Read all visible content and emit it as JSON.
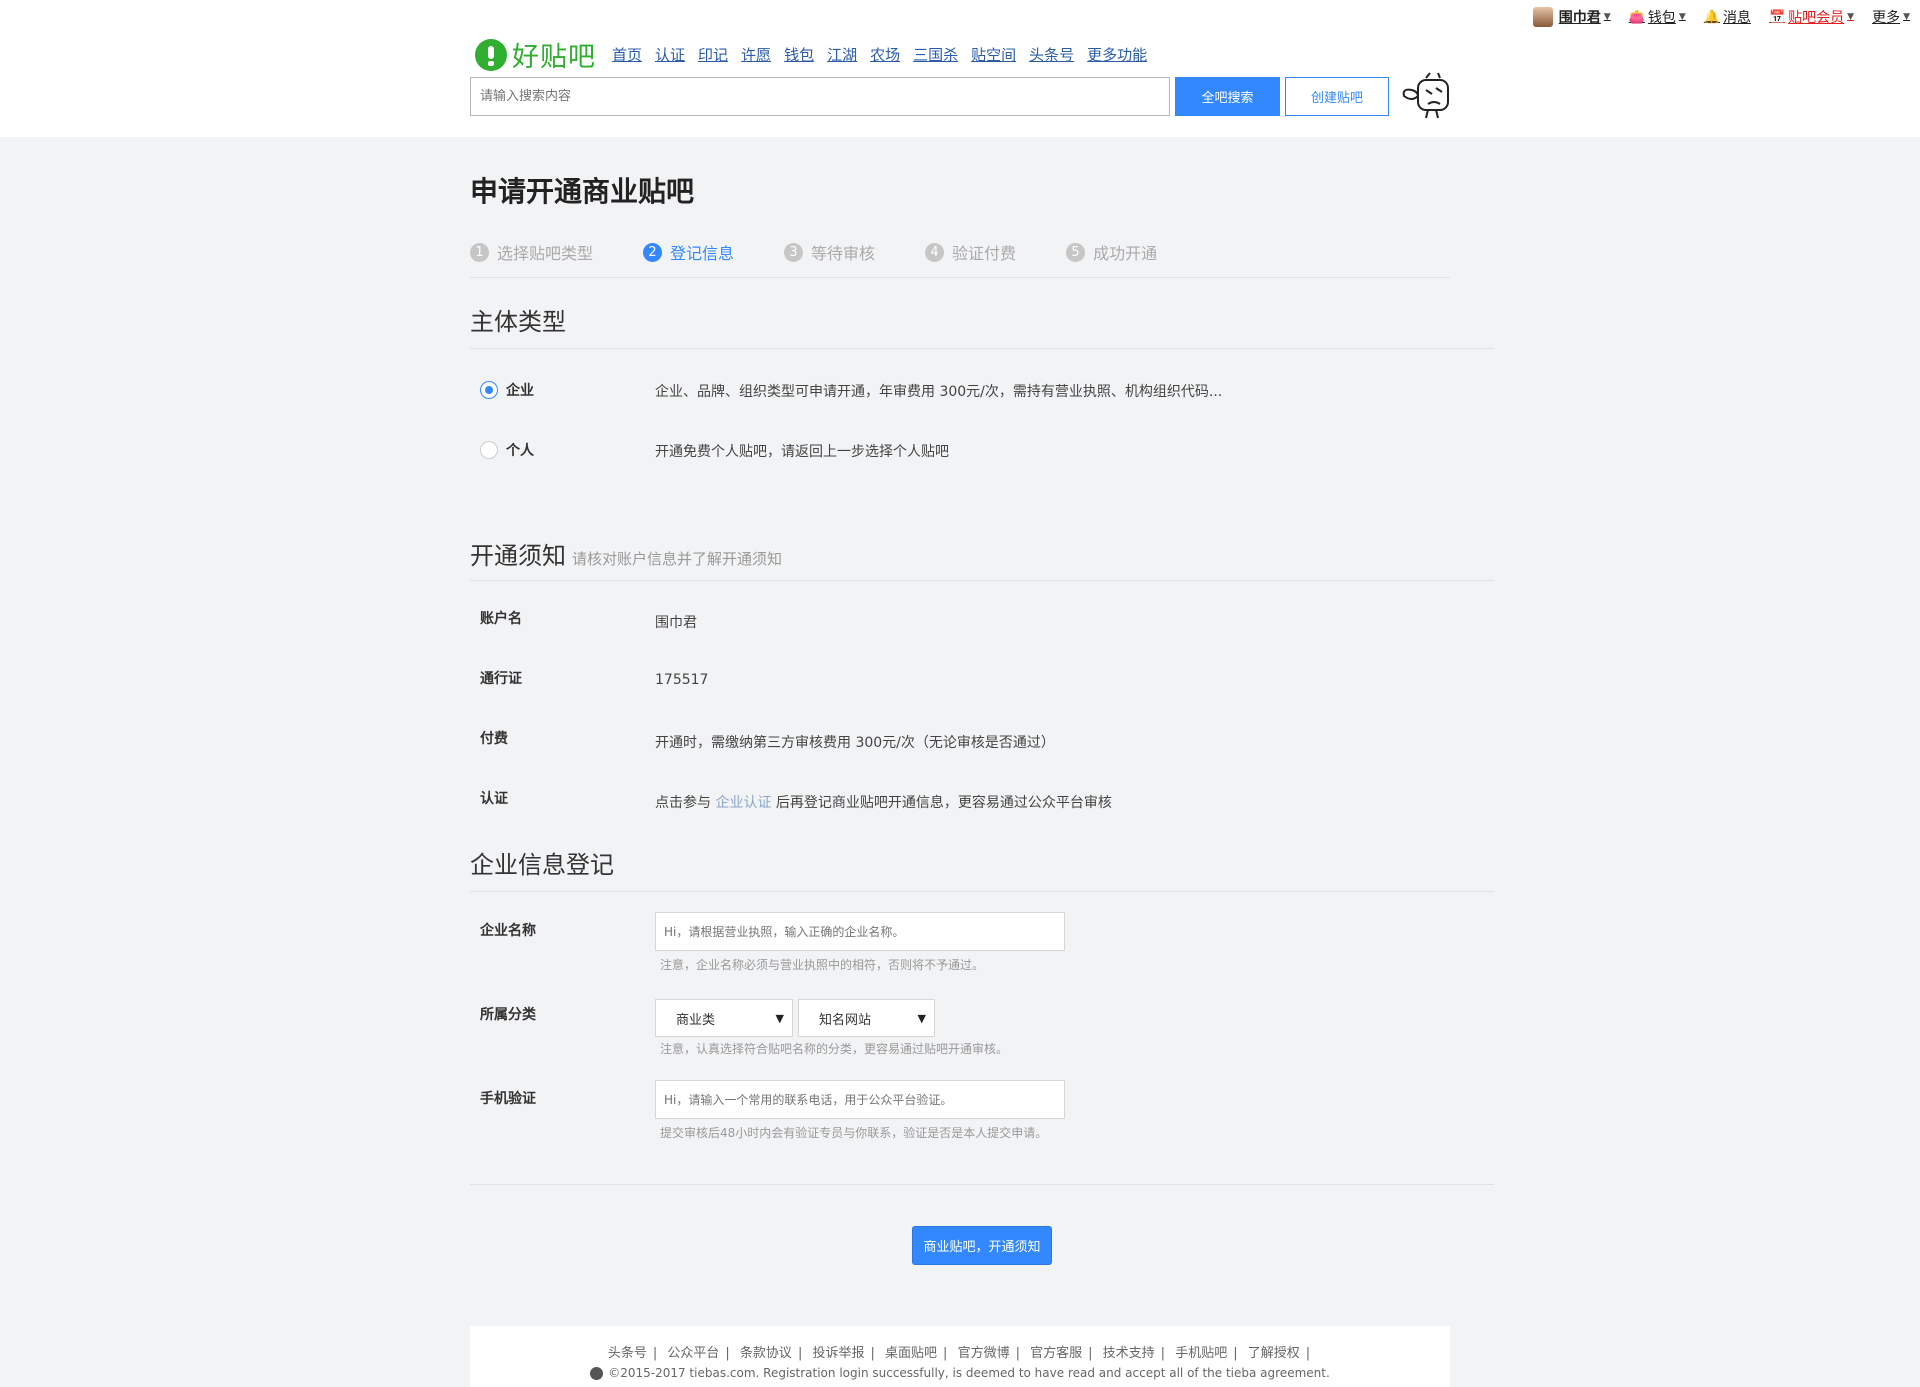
{
  "userbar": {
    "username": "围巾君",
    "wallet": "钱包",
    "messages": "消息",
    "member": "贴吧会员",
    "more": "更多"
  },
  "header": {
    "logo_text": "好贴吧",
    "nav": [
      "首页",
      "认证",
      "印记",
      "许愿",
      "钱包",
      "江湖",
      "农场",
      "三国杀",
      "贴空间",
      "头条号",
      "更多功能"
    ],
    "search_placeholder": "请输入搜索内容",
    "search_button": "全吧搜索",
    "create_button": "创建贴吧"
  },
  "page": {
    "title": "申请开通商业贴吧",
    "steps": [
      {
        "num": "1",
        "label": "选择贴吧类型"
      },
      {
        "num": "2",
        "label": "登记信息"
      },
      {
        "num": "3",
        "label": "等待审核"
      },
      {
        "num": "4",
        "label": "验证付费"
      },
      {
        "num": "5",
        "label": "成功开通"
      }
    ]
  },
  "subject": {
    "title": "主体类型",
    "options": [
      {
        "label": "企业",
        "desc": "企业、品牌、组织类型可申请开通，年审费用 300元/次，需持有营业执照、机构组织代码..."
      },
      {
        "label": "个人",
        "desc": "开通免费个人贴吧，请返回上一步选择个人贴吧"
      }
    ]
  },
  "notice": {
    "title": "开通须知",
    "subtitle": "请核对账户信息并了解开通须知",
    "rows": [
      {
        "label": "账户名",
        "value": "围巾君"
      },
      {
        "label": "通行证",
        "value": "175517"
      },
      {
        "label": "付费",
        "value": "开通时，需缴纳第三方审核费用 300元/次（无论审核是否通过）"
      }
    ],
    "cert_label": "认证",
    "cert_before": "点击参与",
    "cert_link": "企业认证",
    "cert_after": "后再登记商业贴吧开通信息，更容易通过公众平台审核"
  },
  "form": {
    "title": "企业信息登记",
    "company_label": "企业名称",
    "company_placeholder": "Hi，请根据营业执照，输入正确的企业名称。",
    "company_hint": "注意，企业名称必须与营业执照中的相符，否则将不予通过。",
    "category_label": "所属分类",
    "category_1": "商业类",
    "category_2": "知名网站",
    "category_hint": "注意，认真选择符合贴吧名称的分类，更容易通过贴吧开通审核。",
    "phone_label": "手机验证",
    "phone_placeholder": "Hi，请输入一个常用的联系电话，用于公众平台验证。",
    "phone_hint": "提交审核后48小时内会有验证专员与你联系，验证是否是本人提交申请。",
    "submit": "商业贴吧，开通须知"
  },
  "footer": {
    "links": [
      "头条号",
      "公众平台",
      "条款协议",
      "投诉举报",
      "桌面贴吧",
      "官方微博",
      "官方客服",
      "技术支持",
      "手机贴吧",
      "了解授权"
    ],
    "copyright": "©2015-2017 tiebas.com. Registration login successfully, is deemed to have read and accept all of the tieba agreement."
  }
}
